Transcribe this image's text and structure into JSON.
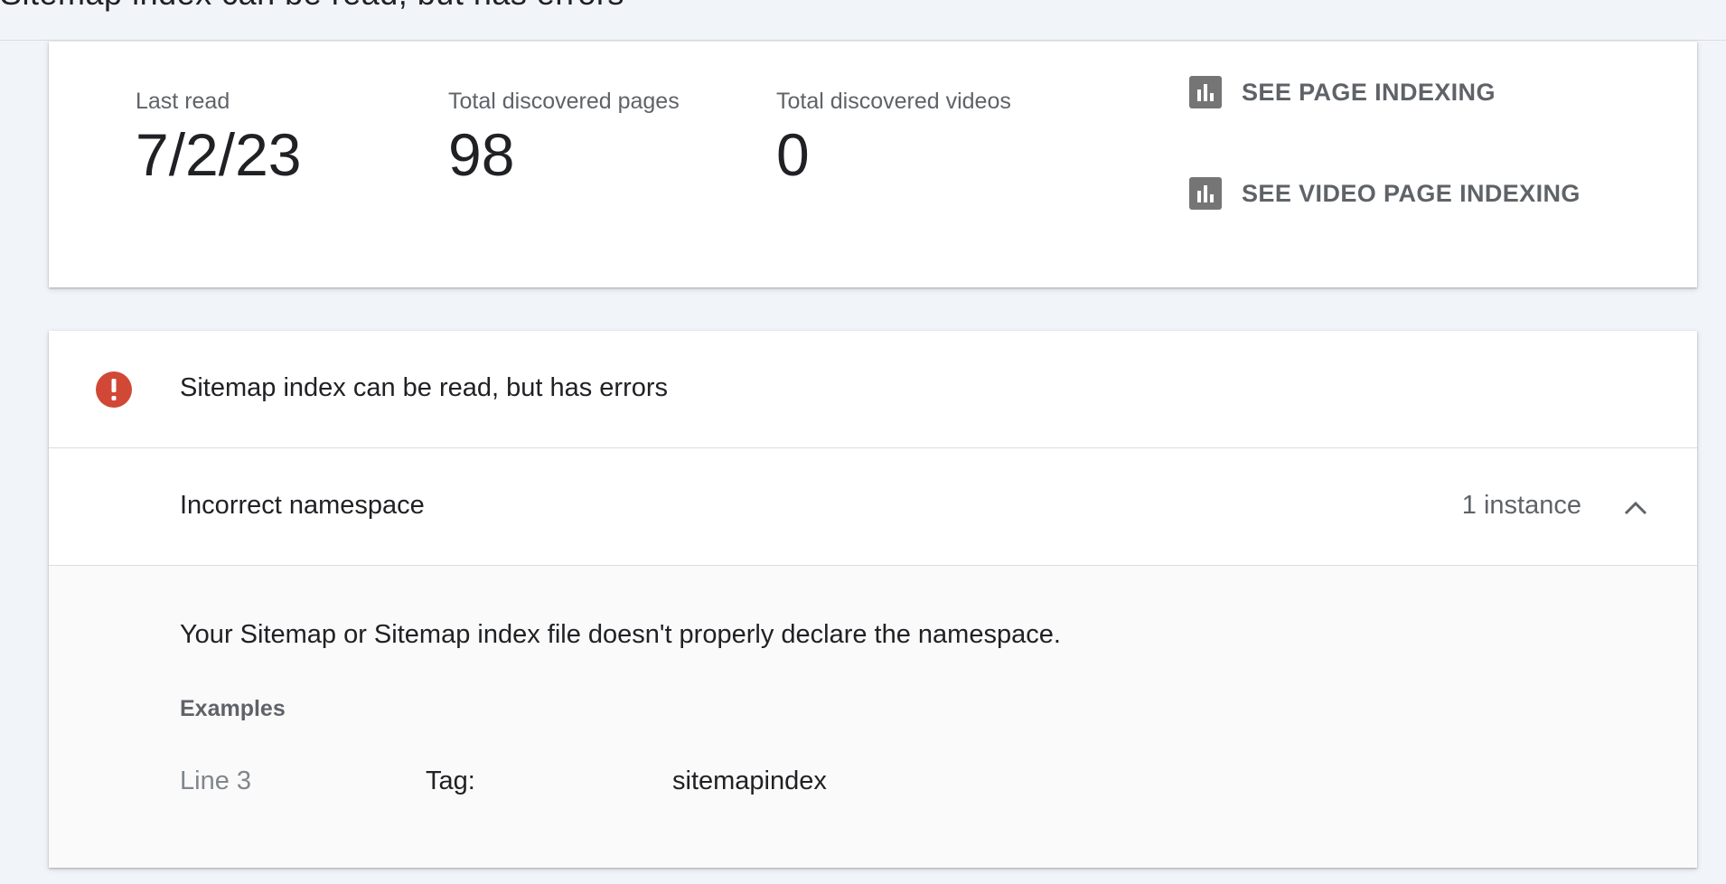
{
  "header": {
    "title_fragment": "Sitemap index can be read, but has errors"
  },
  "summary": {
    "last_read_label": "Last read",
    "last_read_value": "7/2/23",
    "pages_label": "Total discovered pages",
    "pages_value": "98",
    "videos_label": "Total discovered videos",
    "videos_value": "0",
    "see_page_indexing": "SEE PAGE INDEXING",
    "see_video_page_indexing": "SEE VIDEO PAGE INDEXING",
    "icon": "bar-chart-icon"
  },
  "error_section": {
    "title": "Sitemap index can be read, but has errors",
    "icon": "error-icon",
    "error_color": "#d14836",
    "issue": {
      "name": "Incorrect namespace",
      "count": "1 instance",
      "description": "Your Sitemap or Sitemap index file doesn't properly declare the namespace.",
      "examples_label": "Examples",
      "examples": [
        {
          "line": "Line 3",
          "tag_label": "Tag:",
          "tag_value": "sitemapindex"
        }
      ]
    }
  }
}
